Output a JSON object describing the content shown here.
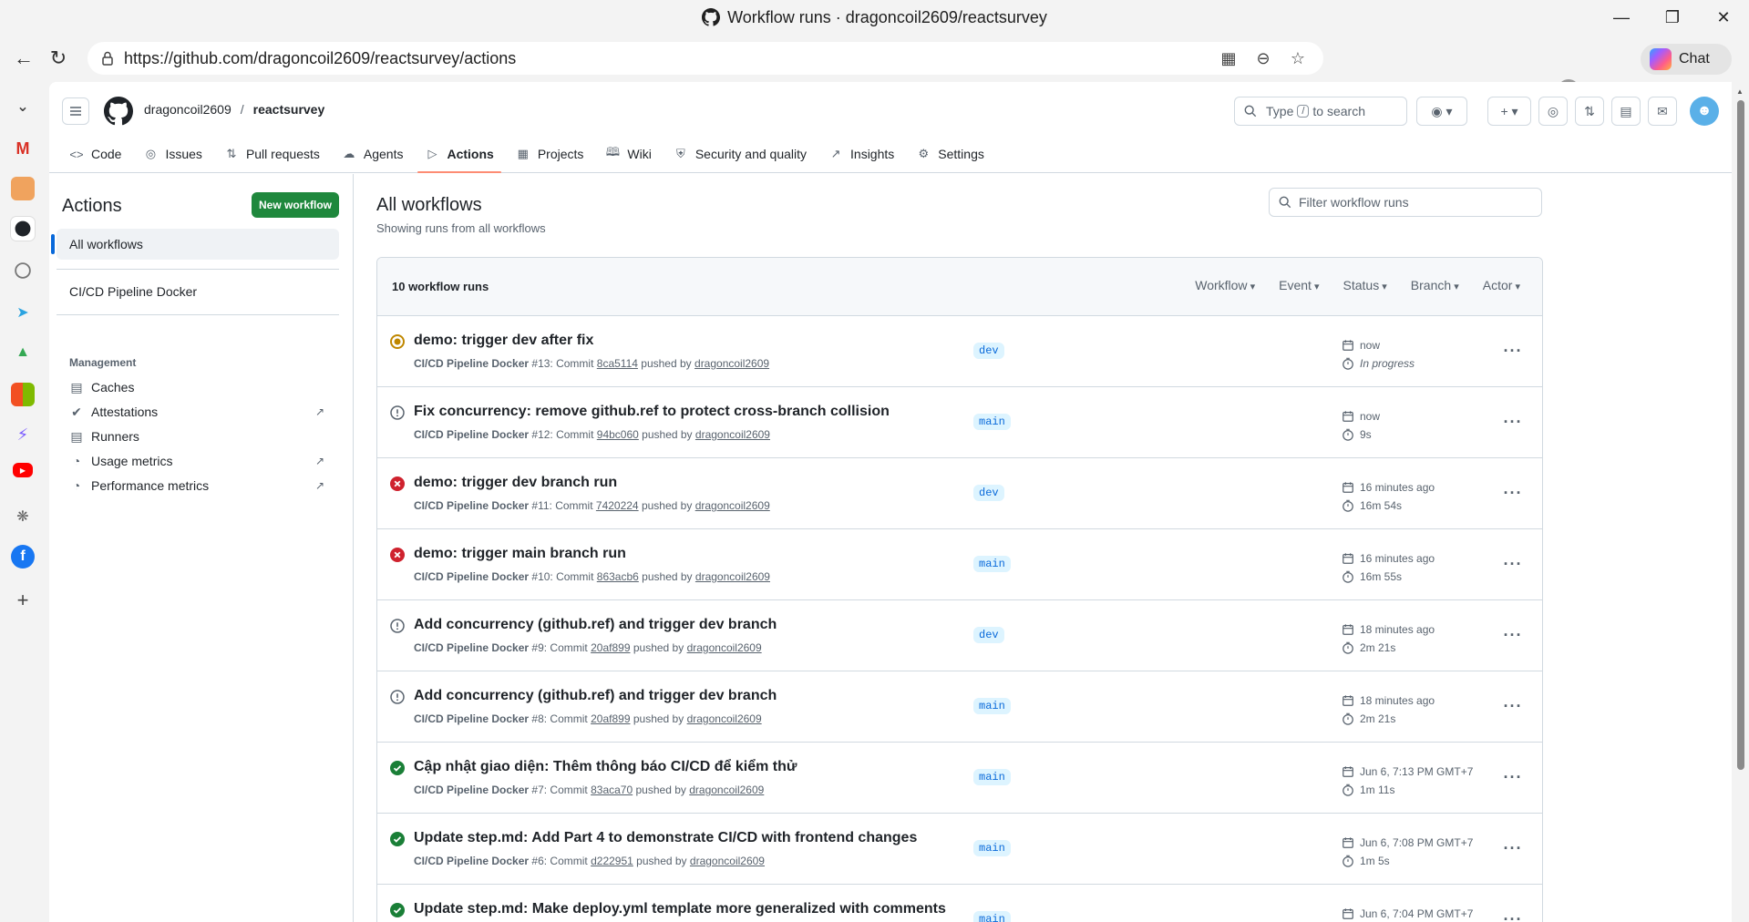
{
  "window": {
    "title": "Workflow runs · dragoncoil2609/reactsurvey"
  },
  "browser": {
    "url": "https://github.com/dragoncoil2609/reactsurvey/actions",
    "chat_label": "Chat"
  },
  "header": {
    "owner": "dragoncoil2609",
    "separator": "/",
    "repo": "reactsurvey",
    "search_prefix": "Type",
    "search_key": "/",
    "search_suffix": "to search"
  },
  "repo_nav": [
    {
      "label": "Code",
      "icon": "code-icon"
    },
    {
      "label": "Issues",
      "icon": "issue-icon"
    },
    {
      "label": "Pull requests",
      "icon": "pull-request-icon"
    },
    {
      "label": "Agents",
      "icon": "agent-icon"
    },
    {
      "label": "Actions",
      "icon": "play-icon",
      "active": true
    },
    {
      "label": "Projects",
      "icon": "table-icon"
    },
    {
      "label": "Wiki",
      "icon": "book-icon"
    },
    {
      "label": "Security and quality",
      "icon": "shield-icon"
    },
    {
      "label": "Insights",
      "icon": "graph-icon"
    },
    {
      "label": "Settings",
      "icon": "gear-icon"
    }
  ],
  "sidebar": {
    "title": "Actions",
    "new_workflow": "New workflow",
    "all_workflows": "All workflows",
    "workflow": "CI/CD Pipeline Docker",
    "management_label": "Management",
    "management": [
      {
        "label": "Caches",
        "icon": "cache-icon",
        "external": false
      },
      {
        "label": "Attestations",
        "icon": "verified-icon",
        "external": true
      },
      {
        "label": "Runners",
        "icon": "server-icon",
        "external": false
      },
      {
        "label": "Usage metrics",
        "icon": "meter-icon",
        "external": true
      },
      {
        "label": "Performance metrics",
        "icon": "meter-icon",
        "external": true
      }
    ]
  },
  "main": {
    "title": "All workflows",
    "subtitle": "Showing runs from all workflows",
    "filter_placeholder": "Filter workflow runs",
    "runs_count": "10 workflow runs",
    "filters": [
      "Workflow",
      "Event",
      "Status",
      "Branch",
      "Actor"
    ]
  },
  "runs": [
    {
      "status": "in-progress",
      "title": "demo: trigger dev after fix",
      "workflow": "CI/CD Pipeline Docker",
      "number": "#13",
      "commit": "8ca5114",
      "actor": "dragoncoil2609",
      "branch": "dev",
      "time": "now",
      "duration": "In progress"
    },
    {
      "status": "cancelled",
      "title": "Fix concurrency: remove github.ref to protect cross-branch collision",
      "workflow": "CI/CD Pipeline Docker",
      "number": "#12",
      "commit": "94bc060",
      "actor": "dragoncoil2609",
      "branch": "main",
      "time": "now",
      "duration": "9s"
    },
    {
      "status": "failure",
      "title": "demo: trigger dev branch run",
      "workflow": "CI/CD Pipeline Docker",
      "number": "#11",
      "commit": "7420224",
      "actor": "dragoncoil2609",
      "branch": "dev",
      "time": "16 minutes ago",
      "duration": "16m 54s"
    },
    {
      "status": "failure",
      "title": "demo: trigger main branch run",
      "workflow": "CI/CD Pipeline Docker",
      "number": "#10",
      "commit": "863acb6",
      "actor": "dragoncoil2609",
      "branch": "main",
      "time": "16 minutes ago",
      "duration": "16m 55s"
    },
    {
      "status": "cancelled",
      "title": "Add concurrency (github.ref) and trigger dev branch",
      "workflow": "CI/CD Pipeline Docker",
      "number": "#9",
      "commit": "20af899",
      "actor": "dragoncoil2609",
      "branch": "dev",
      "time": "18 minutes ago",
      "duration": "2m 21s"
    },
    {
      "status": "cancelled",
      "title": "Add concurrency (github.ref) and trigger dev branch",
      "workflow": "CI/CD Pipeline Docker",
      "number": "#8",
      "commit": "20af899",
      "actor": "dragoncoil2609",
      "branch": "main",
      "time": "18 minutes ago",
      "duration": "2m 21s"
    },
    {
      "status": "success",
      "title": "Cập nhật giao diện: Thêm thông báo CI/CD để kiểm thử",
      "workflow": "CI/CD Pipeline Docker",
      "number": "#7",
      "commit": "83aca70",
      "actor": "dragoncoil2609",
      "branch": "main",
      "time": "Jun 6, 7:13 PM GMT+7",
      "duration": "1m 11s"
    },
    {
      "status": "success",
      "title": "Update step.md: Add Part 4 to demonstrate CI/CD with frontend changes",
      "workflow": "CI/CD Pipeline Docker",
      "number": "#6",
      "commit": "d222951",
      "actor": "dragoncoil2609",
      "branch": "main",
      "time": "Jun 6, 7:08 PM GMT+7",
      "duration": "1m 5s"
    },
    {
      "status": "success",
      "title": "Update step.md: Make deploy.yml template more generalized with comments",
      "workflow": "",
      "number": "",
      "commit": "",
      "actor": "",
      "branch": "main",
      "time": "Jun 6, 7:04 PM GMT+7",
      "duration": ""
    }
  ],
  "labels": {
    "commit_word": "Commit",
    "pushed_by": "pushed by"
  },
  "colors": {
    "success": "#1a7f37",
    "failure": "#cf222e",
    "in_progress": "#bf8700",
    "neutral": "#59636e",
    "primary": "#1f883d",
    "accent": "#0969da"
  }
}
